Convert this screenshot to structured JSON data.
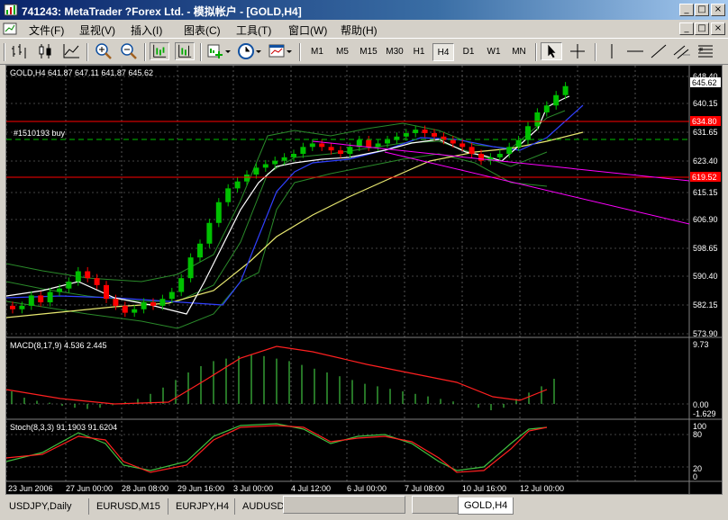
{
  "window": {
    "title": "741243: MetaTrader ?Forex Ltd. - 模拟帐户 - [GOLD,H4]",
    "buttons": [
      "_",
      "□",
      "×"
    ]
  },
  "menu": {
    "items": [
      "文件(F)",
      "显视(V)",
      "插入(I)",
      "图表(C)",
      "工具(T)",
      "窗口(W)",
      "帮助(H)"
    ],
    "mdi_buttons": [
      "_",
      "□",
      "×"
    ]
  },
  "toolbar": {
    "timeframes": [
      "M1",
      "M5",
      "M15",
      "M30",
      "H1",
      "H4",
      "D1",
      "W1",
      "MN"
    ],
    "active_timeframe": "H4"
  },
  "chart": {
    "symbol_info": "GOLD,H4  641.87 647.11 641.87 645.62",
    "order_label": "#1510193 buy",
    "price_labels": [
      "648.40",
      "640.15",
      "631.65",
      "623.40",
      "615.15",
      "606.90",
      "598.65",
      "590.40",
      "582.15",
      "573.90"
    ],
    "current_price": "645.62",
    "red_line_prices": [
      "634.80",
      "619.52"
    ],
    "macd_label": "MACD(8,17,9) 4.536 2.445",
    "macd_scale": [
      "9.73",
      "0.00",
      "-1.629"
    ],
    "stoch_label": "Stoch(8,3,3) 91.1903 91.6204",
    "stoch_scale": [
      "100",
      "80",
      "20",
      "0"
    ],
    "time_labels": [
      "23 Jun 2006",
      "27 Jun 00:00",
      "28 Jun 08:00",
      "29 Jun 16:00",
      "3 Jul 00:00",
      "4 Jul 12:00",
      "6 Jul 00:00",
      "7 Jul 08:00",
      "10 Jul 16:00",
      "12 Jul 00:00"
    ],
    "colors": {
      "bull": "#00c000",
      "bear": "#ff0000",
      "ma_fast": "#ffffff",
      "ma_mid": "#3040ff",
      "ma_slow": "#e8e870",
      "bands": "#2a8a2a",
      "trend": "#ff00ff",
      "grid": "#8a8a8a"
    }
  },
  "tabs": {
    "items": [
      "USDJPY,Daily",
      "EURUSD,M15",
      "EURJPY,H4",
      "AUDUSD,...",
      "GOLD,H4"
    ],
    "active": "GOLD,H4"
  }
}
